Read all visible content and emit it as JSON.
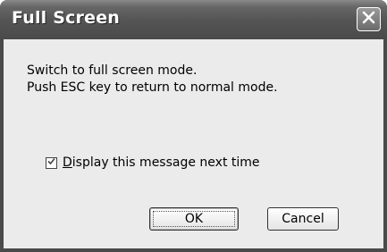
{
  "window": {
    "title": "Full Screen"
  },
  "message": {
    "line1": "Switch to full screen mode.",
    "line2": "Push ESC key to return to normal mode."
  },
  "checkbox": {
    "label_mnemonic": "D",
    "label_rest": "isplay this message next time",
    "checked": true
  },
  "buttons": {
    "ok": "OK",
    "cancel": "Cancel"
  },
  "icons": {
    "close": "close-icon",
    "check": "check-icon"
  },
  "colors": {
    "titlebar": "#555555",
    "client": "#ebebeb"
  }
}
